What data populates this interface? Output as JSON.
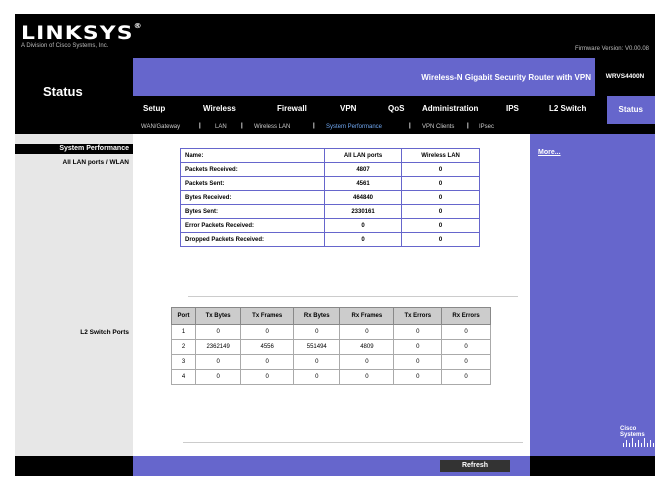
{
  "brand": {
    "logo": "LINKSYS",
    "logo_mark": "®",
    "tagline": "A Division of Cisco Systems, Inc.",
    "firmware": "Firmware Version: V0.00.08"
  },
  "page_title": "Status",
  "model": {
    "name": "Wireless-N Gigabit Security Router with VPN",
    "code": "WRVS4400N"
  },
  "tabs": [
    {
      "label": "Setup"
    },
    {
      "label": "Wireless"
    },
    {
      "label": "Firewall"
    },
    {
      "label": "VPN"
    },
    {
      "label": "QoS"
    },
    {
      "label": "Administration"
    },
    {
      "label": "IPS"
    },
    {
      "label": "L2 Switch"
    },
    {
      "label": "Status"
    }
  ],
  "subtabs": [
    {
      "label": "WAN/Gateway"
    },
    {
      "label": "LAN"
    },
    {
      "label": "Wireless LAN"
    },
    {
      "label": "System Performance"
    },
    {
      "label": "VPN Clients"
    },
    {
      "label": "IPsec"
    }
  ],
  "left": {
    "section": "System Performance",
    "lan_label": "All LAN ports / WLAN",
    "l2_label": "L2 Switch Ports"
  },
  "right": {
    "more": "More...",
    "cisco": "Cisco Systems"
  },
  "perf_table": {
    "headers": [
      "Name:",
      "All LAN ports",
      "Wireless LAN"
    ],
    "rows": [
      [
        "Packets Received:",
        "4807",
        "0"
      ],
      [
        "Packets Sent:",
        "4561",
        "0"
      ],
      [
        "Bytes Received:",
        "464840",
        "0"
      ],
      [
        "Bytes Sent:",
        "2330161",
        "0"
      ],
      [
        "Error Packets Received:",
        "0",
        "0"
      ],
      [
        "Dropped Packets Received:",
        "0",
        "0"
      ]
    ]
  },
  "port_table": {
    "headers": [
      "Port",
      "Tx Bytes",
      "Tx Frames",
      "Rx Bytes",
      "Rx Frames",
      "Tx Errors",
      "Rx Errors"
    ],
    "rows": [
      [
        "1",
        "0",
        "0",
        "0",
        "0",
        "0",
        "0"
      ],
      [
        "2",
        "2362149",
        "4556",
        "551494",
        "4809",
        "0",
        "0"
      ],
      [
        "3",
        "0",
        "0",
        "0",
        "0",
        "0",
        "0"
      ],
      [
        "4",
        "0",
        "0",
        "0",
        "0",
        "0",
        "0"
      ]
    ]
  },
  "buttons": {
    "refresh": "Refresh"
  },
  "colors": {
    "accent": "#6666cc",
    "header": "#000000",
    "active_subtab": "#6fa6f0"
  }
}
